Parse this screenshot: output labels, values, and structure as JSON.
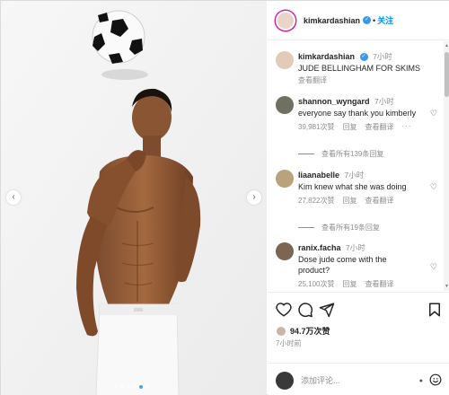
{
  "header": {
    "username": "kimkardashian",
    "follow_label": "关注",
    "separator": "•"
  },
  "caption": {
    "username": "kimkardashian",
    "time": "7小时",
    "text": "JUDE BELLINGHAM FOR SKIMS",
    "translate": "查看翻译"
  },
  "comments": [
    {
      "username": "shannon_wyngard",
      "time": "7小时",
      "text": "everyone say thank you kimberly",
      "likes": "39,981次赞",
      "reply": "回复",
      "translate": "查看翻译",
      "more": "···",
      "replies": "查看所有139条回复"
    },
    {
      "username": "liaanabelle",
      "time": "7小时",
      "text": "Kim knew what she was doing",
      "likes": "27,822次赞",
      "reply": "回复",
      "translate": "查看翻译",
      "replies": "查看所有19条回复"
    },
    {
      "username": "ranix.facha",
      "time": "7小时",
      "text": "Dose jude come with the product?",
      "likes": "25,100次赞",
      "reply": "回复",
      "translate": "查看翻译"
    }
  ],
  "post": {
    "likes": "94.7万次赞",
    "time": "7小时前"
  },
  "add_comment": {
    "placeholder": "添加评论..."
  },
  "icons": {
    "like": "heart-icon",
    "comment": "comment-icon",
    "share": "send-icon",
    "save": "bookmark-icon",
    "emoji": "emoji-icon",
    "prev": "chevron-left-icon",
    "next": "chevron-right-icon"
  },
  "colors": {
    "accent": "#0095f6",
    "verified": "#3897f0",
    "muted": "#8e8e8e"
  },
  "carousel": {
    "slides": 6,
    "active": 4
  }
}
